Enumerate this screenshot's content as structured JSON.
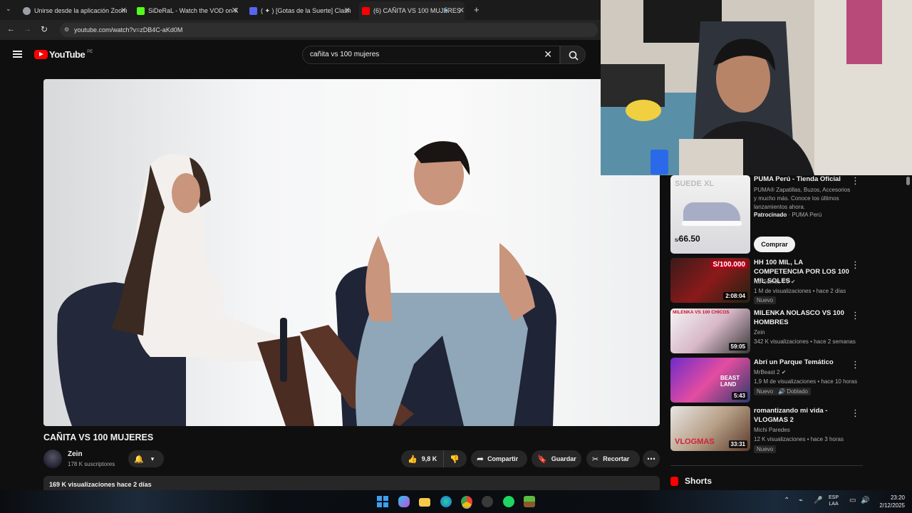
{
  "browser": {
    "tabs": [
      {
        "label": "Unirse desde la aplicación Zoom",
        "color": "#9aa0a6"
      },
      {
        "label": "SiDeRaL - Watch the VOD on Kick",
        "color": "#53fc18"
      },
      {
        "label": "( ✦ ) [Gotas de la Suerte] Clash",
        "color": "#5865f2"
      },
      {
        "label": "(6) CAÑITA VS 100 MUJERES",
        "color": "#ff0000"
      }
    ],
    "url": "youtube.com/watch?v=zDB4C-aKd0M"
  },
  "youtube": {
    "logo": "YouTube",
    "region": "PE",
    "search_value": "cañita vs 100 mujeres"
  },
  "video": {
    "title": "CAÑITA VS 100 MUJERES",
    "channel": "Zein",
    "subscribers": "178 K suscriptores",
    "likes": "9,8 K",
    "share": "Compartir",
    "save": "Guardar",
    "clip": "Recortar",
    "desc_meta": "169 K visualizaciones  hace 2 días"
  },
  "ad": {
    "title": "PUMA Perú - Tienda Oficial",
    "desc": "PUMA® Zapatillas, Buzos, Accesorios y mucho más. Conoce los últimos lanzamientos ahora.",
    "sponsored": "Patrocinado",
    "advertiser": "· PUMA Perú",
    "cta": "Comprar",
    "thumb_text": "SUEDE XL",
    "price": "66.50"
  },
  "related": [
    {
      "title": "HH 100 MIL, LA COMPETENCIA POR LOS 100 MIL SOLES",
      "channel": "No Somos TV",
      "meta": "1 M de visualizaciones • hace 2 días",
      "badge": "Nuevo",
      "duration": "2:08:04",
      "overlay": "S/100.000"
    },
    {
      "title": "MILENKA NOLASCO VS 100 HOMBRES",
      "channel": "Zein",
      "meta": "342 K visualizaciones • hace 2 semanas",
      "badge": "",
      "duration": "59:05",
      "overlay": "MILENKA VS 100 CHICOS"
    },
    {
      "title": "Abrí un Parque Temático",
      "channel": "MrBeast 2",
      "meta": "1,9 M de visualizaciones • hace 10 horas",
      "badge": "Nuevo",
      "badge2": "Doblado",
      "duration": "5:43",
      "overlay": "BEAST LAND"
    },
    {
      "title": "romantizando mi vida - VLOGMAS 2",
      "channel": "Michi Paredes",
      "meta": "12 K visualizaciones • hace 3 horas",
      "badge": "Nuevo",
      "duration": "33:31",
      "overlay": "VLOGMAS"
    }
  ],
  "shorts_label": "Shorts",
  "system": {
    "lang": "ESP",
    "lang2": "LAA",
    "time": "23:20",
    "date": "2/12/2025"
  }
}
